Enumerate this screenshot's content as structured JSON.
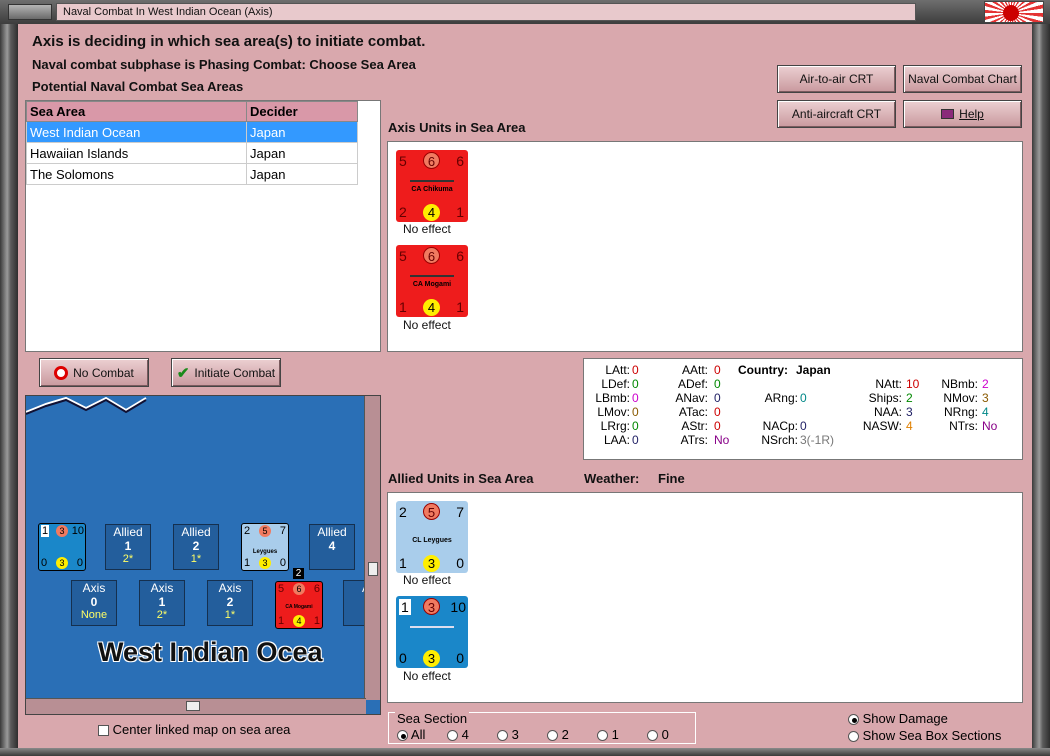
{
  "window": {
    "title": "Naval Combat In West Indian Ocean (Axis)"
  },
  "header": {
    "line1": "Axis is deciding in which sea area(s) to initiate combat.",
    "line2": "Naval combat subphase is Phasing Combat: Choose Sea Area",
    "line3": "Potential Naval Combat Sea Areas"
  },
  "buttons": {
    "air_to_air": "Air-to-air CRT",
    "naval_chart": "Naval Combat Chart",
    "anti_aircraft": "Anti-aircraft CRT",
    "help": "Help",
    "no_combat": "No Combat",
    "initiate_combat": "Initiate Combat"
  },
  "sea_table": {
    "headers": [
      "Sea Area",
      "Decider"
    ],
    "rows": [
      [
        "West Indian Ocean",
        "Japan"
      ],
      [
        "Hawaiian Islands",
        "Japan"
      ],
      [
        "The Solomons",
        "Japan"
      ]
    ]
  },
  "axis_units": {
    "label": "Axis Units in Sea Area",
    "units": [
      {
        "name": "CA Chikuma",
        "tl": "5",
        "tc": "6",
        "tr": "6",
        "bl": "2",
        "bc": "4",
        "br": "1",
        "status": "No effect"
      },
      {
        "name": "CA Mogami",
        "tl": "5",
        "tc": "6",
        "tr": "6",
        "bl": "1",
        "bc": "4",
        "br": "1",
        "status": "No effect"
      }
    ]
  },
  "stats": {
    "latt_l": "LAtt:",
    "latt_v": "0",
    "ldef_l": "LDef:",
    "ldef_v": "0",
    "lbmb_l": "LBmb:",
    "lbmb_v": "0",
    "lmov_l": "LMov:",
    "lmov_v": "0",
    "lrrg_l": "LRrg:",
    "lrrg_v": "0",
    "laa_l": "LAA:",
    "laa_v": "0",
    "aatt_l": "AAtt:",
    "aatt_v": "0",
    "adef_l": "ADef:",
    "adef_v": "0",
    "anav_l": "ANav:",
    "anav_v": "0",
    "atac_l": "ATac:",
    "atac_v": "0",
    "astr_l": "AStr:",
    "astr_v": "0",
    "atrs_l": "ATrs:",
    "atrs_v": "No",
    "country_l": "Country:",
    "country_v": "Japan",
    "arng_l": "ARng:",
    "arng_v": "0",
    "nacp_l": "NACp:",
    "nacp_v": "0",
    "nsrch_l": "NSrch:",
    "nsrch_v": "3(-1R)",
    "natt_l": "NAtt:",
    "natt_v": "10",
    "ships_l": "Ships:",
    "ships_v": "2",
    "naa_l": "NAA:",
    "naa_v": "3",
    "nasw_l": "NASW:",
    "nasw_v": "4",
    "nbmb_l": "NBmb:",
    "nbmb_v": "2",
    "nmov_l": "NMov:",
    "nmov_v": "3",
    "nrng_l": "NRng:",
    "nrng_v": "4",
    "ntrs_l": "NTrs:",
    "ntrs_v": "No"
  },
  "allied_units": {
    "label": "Allied Units in Sea Area",
    "weather_label": "Weather:",
    "weather_value": "Fine",
    "units": [
      {
        "name": "CL Leygues",
        "tl": "2",
        "tc": "5",
        "tr": "7",
        "bl": "1",
        "bc": "3",
        "br": "0",
        "status": "No effect"
      },
      {
        "name": "",
        "tl": "1",
        "tc": "3",
        "tr": "10",
        "bl": "0",
        "bc": "3",
        "br": "0",
        "status": "No effect"
      }
    ]
  },
  "map": {
    "sea_name": "West Indian Ocea",
    "allied_boxes": [
      {
        "side": "Allied",
        "num": "1",
        "sub": "2*"
      },
      {
        "side": "Allied",
        "num": "2",
        "sub": "1*"
      },
      {
        "side": "Allied",
        "num": "4",
        "sub": ""
      }
    ],
    "axis_boxes": [
      {
        "side": "Axis",
        "num": "0",
        "sub": "None"
      },
      {
        "side": "Axis",
        "num": "1",
        "sub": "2*"
      },
      {
        "side": "Axis",
        "num": "2",
        "sub": "1*"
      },
      {
        "side": "A",
        "num": "",
        "sub": ""
      }
    ],
    "stack_count": "2",
    "mini_counters": {
      "allied_a": {
        "tl": "1",
        "tc": "3",
        "tr": "10",
        "bl": "0",
        "bc": "3",
        "br": "0"
      },
      "allied_b": {
        "tl": "2",
        "tc": "5",
        "tr": "7",
        "bl": "1",
        "bc": "3",
        "br": "0",
        "name": "Leygues"
      },
      "axis": {
        "tl": "5",
        "tc": "6",
        "tr": "6",
        "bl": "1",
        "bc": "4",
        "br": "1",
        "name": "CA Mogami"
      }
    }
  },
  "footer": {
    "center_map": "Center linked map on sea area",
    "sea_section_label": "Sea Section",
    "sea_section_options": [
      "All",
      "4",
      "3",
      "2",
      "1",
      "0"
    ],
    "show_damage": "Show Damage",
    "show_sections": "Show Sea Box Sections"
  }
}
